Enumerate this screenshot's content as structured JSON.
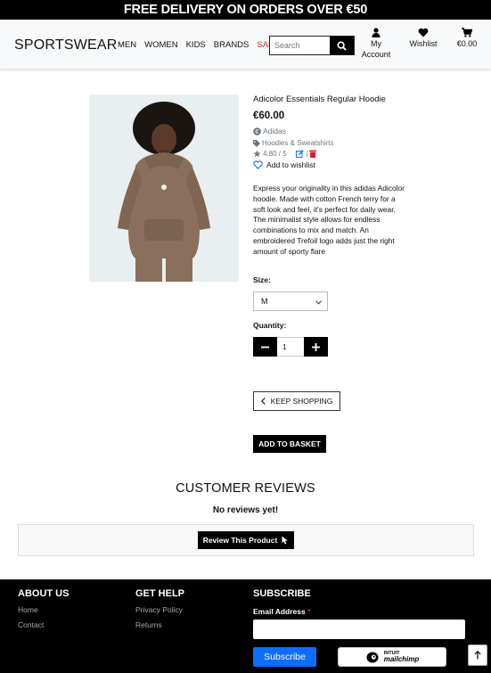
{
  "banner": {
    "text": "FREE DELIVERY ON ORDERS OVER €50"
  },
  "header": {
    "logo": "SPORTSWEAR",
    "nav": [
      "MEN",
      "WOMEN",
      "KIDS",
      "BRANDS",
      "SALE"
    ],
    "search_placeholder": "Search",
    "account_line1": "My",
    "account_line2": "Account",
    "wishlist": "Wishlist",
    "basket_total": "€0.00"
  },
  "product": {
    "name": "Adicolor Essentials Regular Hoodie",
    "price": "€60.00",
    "brand": "Adidas",
    "category": "Hoodies & Sweatshirts",
    "rating": "4.80 / 5",
    "wishlist_link": "Add to wishlist",
    "description": "Express your originality in this adidas Adicolor hoodie. Made with cotton French terry for a soft look and feel, it's perfect for daily wear. The minimalist style allows for endless combinations to mix and match. An embroidered Trefoil logo adds just the right amount of sporty flare",
    "size_label": "Size:",
    "size_value": "M",
    "quantity_label": "Quantity:",
    "quantity_value": "1",
    "keep_shopping": "KEEP SHOPPING",
    "add_to_basket": "ADD TO BASKET"
  },
  "reviews": {
    "title": "CUSTOMER REVIEWS",
    "empty_text": "No reviews yet!",
    "review_button": "Review This Product"
  },
  "footer": {
    "about_title": "ABOUT US",
    "about_links": [
      "Home",
      "Contact"
    ],
    "help_title": "GET HELP",
    "help_links": [
      "Privacy Policy",
      "Returns"
    ],
    "subscribe_title": "SUBSCRIBE",
    "email_label": "Email Address",
    "required_mark": "*",
    "subscribe_button": "Subscribe",
    "mailchimp_line1": "INTUIT",
    "mailchimp_line2": "mailchimp"
  },
  "colors": {
    "sale": "#e0202c",
    "subscribe": "#0d6efd",
    "edit": "#0d6efd",
    "delete": "#e0202c"
  }
}
